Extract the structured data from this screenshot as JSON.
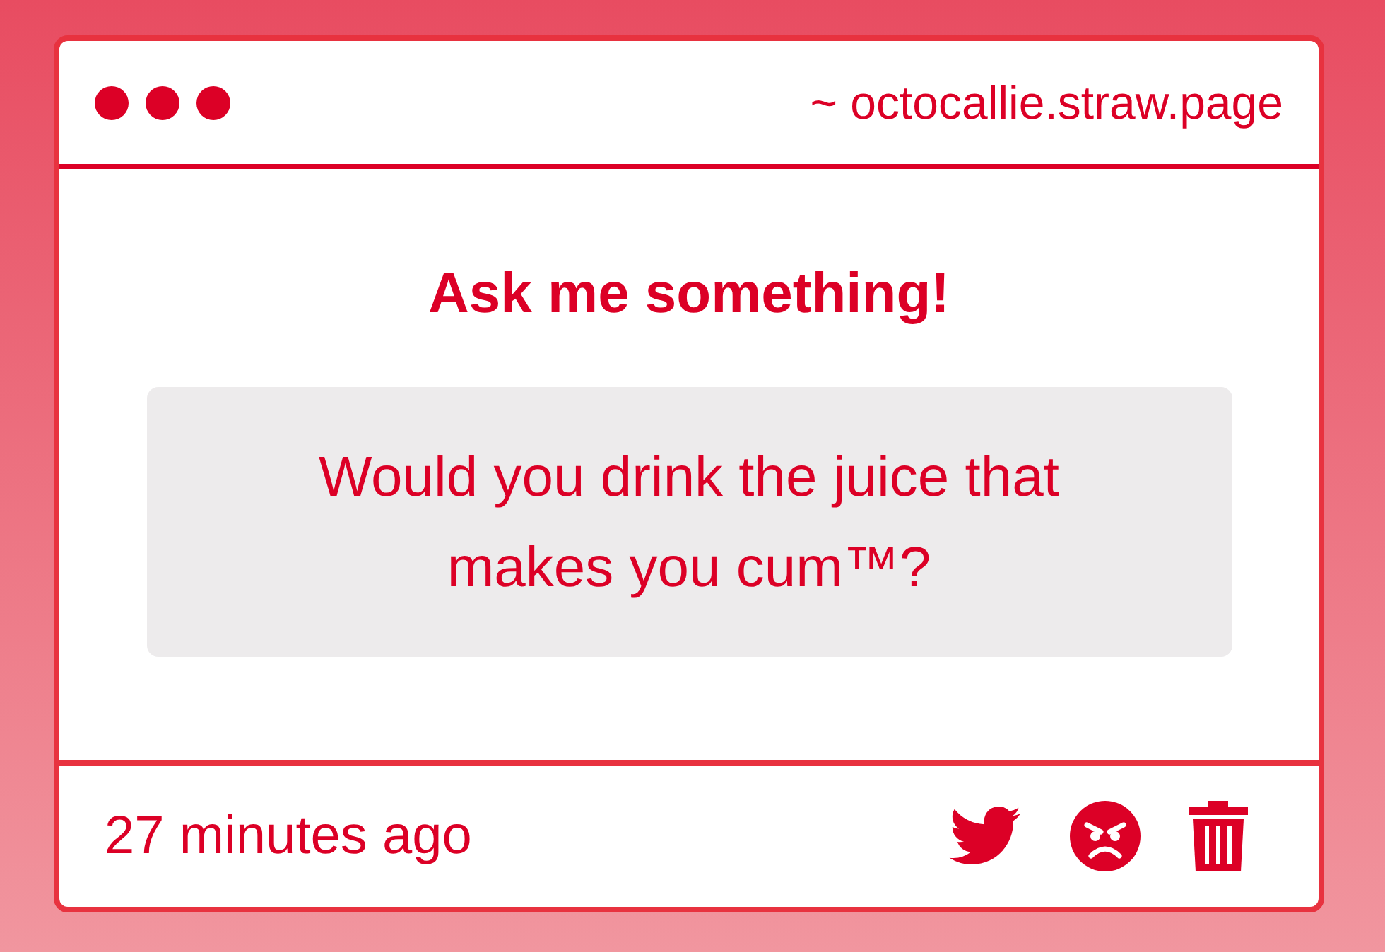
{
  "window": {
    "address": "~ octocallie.straw.page"
  },
  "heading": "Ask me something!",
  "question": "Would you drink the juice that makes you cum™?",
  "footer": {
    "timestamp": "27 minutes ago"
  }
}
